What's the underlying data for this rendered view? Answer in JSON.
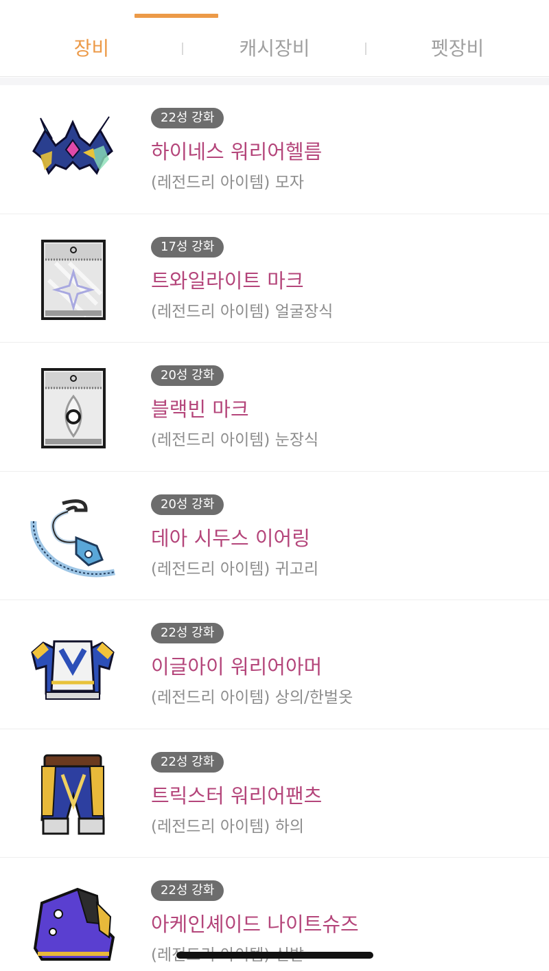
{
  "tabs": [
    {
      "label": "장비",
      "active": true
    },
    {
      "label": "캐시장비",
      "active": false
    },
    {
      "label": "펫장비",
      "active": false
    }
  ],
  "colors": {
    "accent": "#ec9a48",
    "item_name": "#b4457a",
    "badge_bg": "#6d6d6d"
  },
  "items": [
    {
      "badge": "22성 강화",
      "name": "하이네스 워리어헬름",
      "sub": "(레전드리 아이템) 모자",
      "icon": "helmet-icon"
    },
    {
      "badge": "17성 강화",
      "name": "트와일라이트 마크",
      "sub": "(레전드리 아이템) 얼굴장식",
      "icon": "face-accessory-icon"
    },
    {
      "badge": "20성 강화",
      "name": "블랙빈 마크",
      "sub": "(레전드리 아이템) 눈장식",
      "icon": "eye-accessory-icon"
    },
    {
      "badge": "20성 강화",
      "name": "데아 시두스 이어링",
      "sub": "(레전드리 아이템) 귀고리",
      "icon": "earring-icon"
    },
    {
      "badge": "22성 강화",
      "name": "이글아이 워리어아머",
      "sub": "(레전드리 아이템) 상의/한벌옷",
      "icon": "armor-icon"
    },
    {
      "badge": "22성 강화",
      "name": "트릭스터 워리어팬츠",
      "sub": "(레전드리 아이템) 하의",
      "icon": "pants-icon"
    },
    {
      "badge": "22성 강화",
      "name": "아케인셰이드 나이트슈즈",
      "sub": "(레전드리 아이템) 신발",
      "icon": "shoes-icon"
    }
  ]
}
